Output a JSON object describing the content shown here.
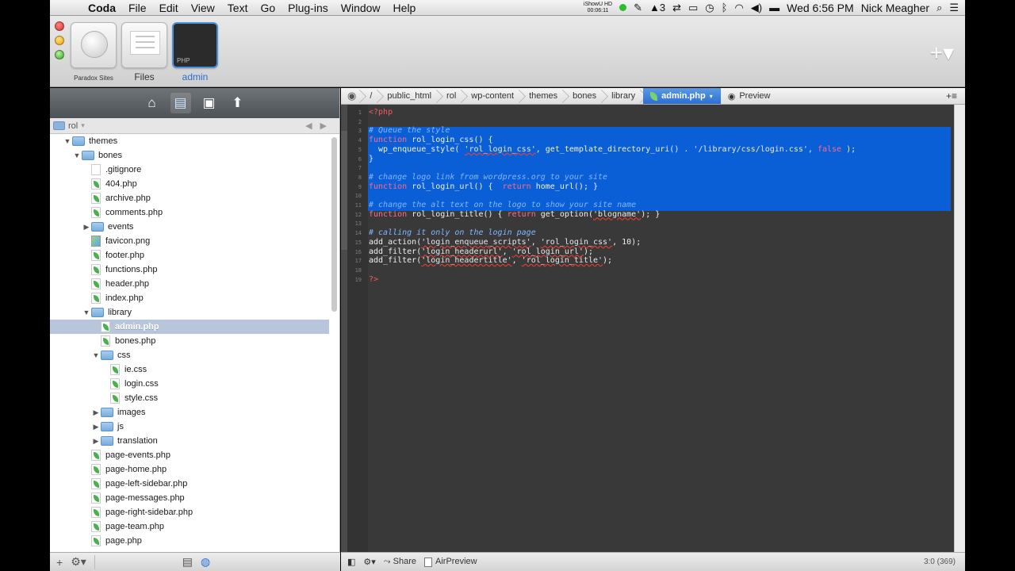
{
  "menubar": {
    "app": "Coda",
    "items": [
      "File",
      "Edit",
      "View",
      "Text",
      "Go",
      "Plug-ins",
      "Window",
      "Help"
    ],
    "ishowu": "iShowU HD",
    "ishowu_time": "00:06:11",
    "adobe_count": "3",
    "clock": "Wed 6:56 PM",
    "user": "Nick Meagher"
  },
  "toolbar": {
    "sites": [
      {
        "label": "Paradox Sites"
      },
      {
        "label": "Files"
      },
      {
        "label": "admin",
        "badge": "PHP"
      }
    ]
  },
  "sidebar": {
    "root": "rol",
    "rows": [
      {
        "label": "themes",
        "kind": "folder",
        "depth": 1,
        "open": true
      },
      {
        "label": "bones",
        "kind": "folder",
        "depth": 2,
        "open": true
      },
      {
        "label": ".gitignore",
        "kind": "plain",
        "depth": 3
      },
      {
        "label": "404.php",
        "kind": "leaf",
        "depth": 3
      },
      {
        "label": "archive.php",
        "kind": "leaf",
        "depth": 3
      },
      {
        "label": "comments.php",
        "kind": "leaf",
        "depth": 3
      },
      {
        "label": "events",
        "kind": "folder",
        "depth": 3,
        "open": false
      },
      {
        "label": "favicon.png",
        "kind": "image",
        "depth": 3
      },
      {
        "label": "footer.php",
        "kind": "leaf",
        "depth": 3
      },
      {
        "label": "functions.php",
        "kind": "leaf",
        "depth": 3
      },
      {
        "label": "header.php",
        "kind": "leaf",
        "depth": 3
      },
      {
        "label": "index.php",
        "kind": "leaf",
        "depth": 3
      },
      {
        "label": "library",
        "kind": "folder",
        "depth": 3,
        "open": true
      },
      {
        "label": "admin.php",
        "kind": "leaf",
        "depth": 4,
        "selected": true
      },
      {
        "label": "bones.php",
        "kind": "leaf",
        "depth": 4
      },
      {
        "label": "css",
        "kind": "folder",
        "depth": 4,
        "open": true
      },
      {
        "label": "ie.css",
        "kind": "leaf",
        "depth": 5
      },
      {
        "label": "login.css",
        "kind": "leaf",
        "depth": 5
      },
      {
        "label": "style.css",
        "kind": "leaf",
        "depth": 5
      },
      {
        "label": "images",
        "kind": "folder",
        "depth": 4,
        "open": false
      },
      {
        "label": "js",
        "kind": "folder",
        "depth": 4,
        "open": false
      },
      {
        "label": "translation",
        "kind": "folder",
        "depth": 4,
        "open": false
      },
      {
        "label": "page-events.php",
        "kind": "leaf",
        "depth": 3
      },
      {
        "label": "page-home.php",
        "kind": "leaf",
        "depth": 3
      },
      {
        "label": "page-left-sidebar.php",
        "kind": "leaf",
        "depth": 3
      },
      {
        "label": "page-messages.php",
        "kind": "leaf",
        "depth": 3
      },
      {
        "label": "page-right-sidebar.php",
        "kind": "leaf",
        "depth": 3
      },
      {
        "label": "page-team.php",
        "kind": "leaf",
        "depth": 3
      },
      {
        "label": "page.php",
        "kind": "leaf",
        "depth": 3
      }
    ]
  },
  "breadcrumbs": {
    "items": [
      "/",
      "public_html",
      "rol",
      "wp-content",
      "themes",
      "bones",
      "library"
    ],
    "current": "admin.php",
    "preview": "Preview"
  },
  "code": {
    "lines": [
      [
        {
          "t": "<?php",
          "c": "t-tag"
        }
      ],
      [],
      [
        {
          "t": "# Queue the style",
          "c": "t-com"
        }
      ],
      [
        {
          "t": "function ",
          "c": "t-kw"
        },
        {
          "t": "rol_login_css() {",
          "c": "t-fn"
        }
      ],
      [
        {
          "t": "  wp_enqueue_style( ",
          "c": "t-fn"
        },
        {
          "t": "'rol_login_css'",
          "c": "t-str t-sq"
        },
        {
          "t": ", get_template_directory_uri() . ",
          "c": "t-fn"
        },
        {
          "t": "'/library/css/login.css'",
          "c": "t-str"
        },
        {
          "t": ", ",
          "c": "t-fn"
        },
        {
          "t": "false",
          "c": "t-kw"
        },
        {
          "t": " );",
          "c": "t-fn"
        }
      ],
      [
        {
          "t": "}",
          "c": "t-fn"
        }
      ],
      [],
      [
        {
          "t": "# change logo link from wordpress.org to your site",
          "c": "t-com"
        }
      ],
      [
        {
          "t": "function ",
          "c": "t-kw"
        },
        {
          "t": "rol_login_url() {  ",
          "c": "t-fn"
        },
        {
          "t": "return ",
          "c": "t-kw"
        },
        {
          "t": "home_url(); }",
          "c": "t-fn"
        }
      ],
      [],
      [
        {
          "t": "# change the alt text on the logo to show your site name",
          "c": "t-com"
        }
      ],
      [
        {
          "t": "function ",
          "c": "t-kw"
        },
        {
          "t": "rol_login_title() { ",
          "c": "t-fn"
        },
        {
          "t": "return ",
          "c": "t-kw"
        },
        {
          "t": "get_option(",
          "c": "t-fn"
        },
        {
          "t": "'blogname'",
          "c": "t-str t-sq"
        },
        {
          "t": "); }",
          "c": "t-fn"
        }
      ],
      [],
      [
        {
          "t": "# calling it only on the login page",
          "c": "t-com"
        }
      ],
      [
        {
          "t": "add_action(",
          "c": "t-fn"
        },
        {
          "t": "'login_enqueue_scripts'",
          "c": "t-str t-sq"
        },
        {
          "t": ", ",
          "c": "t-fn"
        },
        {
          "t": "'rol_login_css'",
          "c": "t-str t-sq"
        },
        {
          "t": ", ",
          "c": "t-fn"
        },
        {
          "t": "10",
          "c": "t-num"
        },
        {
          "t": ");",
          "c": "t-fn"
        }
      ],
      [
        {
          "t": "add_filter(",
          "c": "t-fn"
        },
        {
          "t": "'login_headerurl'",
          "c": "t-str t-sq"
        },
        {
          "t": ", ",
          "c": "t-fn"
        },
        {
          "t": "'rol_login_url'",
          "c": "t-str t-sq"
        },
        {
          "t": ");",
          "c": "t-fn"
        }
      ],
      [
        {
          "t": "add_filter(",
          "c": "t-fn"
        },
        {
          "t": "'login_headertitle'",
          "c": "t-str t-sq"
        },
        {
          "t": ", ",
          "c": "t-fn"
        },
        {
          "t": "'rol_login_title'",
          "c": "t-str t-sq"
        },
        {
          "t": ");",
          "c": "t-fn"
        }
      ],
      [],
      [
        {
          "t": "?>",
          "c": "t-tag"
        }
      ]
    ]
  },
  "footer": {
    "share": "Share",
    "airpreview": "AirPreview",
    "position": "3:0 (369)"
  }
}
